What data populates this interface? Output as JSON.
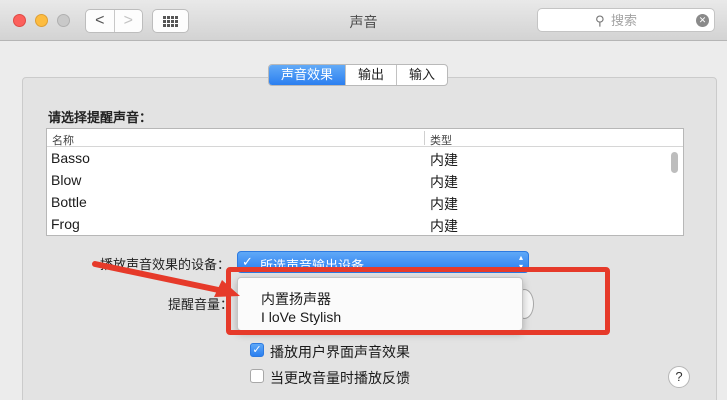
{
  "window": {
    "title": "声音",
    "nav_back": "<",
    "nav_forward": ">",
    "search": {
      "placeholder": "搜索",
      "icon": "search-icon",
      "clear_icon": "clear-icon"
    }
  },
  "tabs": [
    {
      "label": "声音效果",
      "active": true
    },
    {
      "label": "输出",
      "active": false
    },
    {
      "label": "输入",
      "active": false
    }
  ],
  "alert_section": {
    "label": "请选择提醒声音：",
    "columns": [
      "名称",
      "类型"
    ],
    "rows": [
      {
        "name": "Basso",
        "type": "内建"
      },
      {
        "name": "Blow",
        "type": "内建"
      },
      {
        "name": "Bottle",
        "type": "内建"
      },
      {
        "name": "Frog",
        "type": "内建"
      }
    ]
  },
  "device": {
    "label": "播放声音效果的设备：",
    "selected": "所选声音输出设备",
    "options": [
      "内置扬声器",
      "I loVe Stylish"
    ]
  },
  "volume": {
    "label": "提醒音量："
  },
  "checkboxes": [
    {
      "label": "播放用户界面声音效果",
      "checked": true
    },
    {
      "label": "当更改音量时播放反馈",
      "checked": false
    }
  ],
  "help": "?",
  "colors": {
    "accent": "#2b7ff0",
    "annotation": "#e63a2a"
  }
}
